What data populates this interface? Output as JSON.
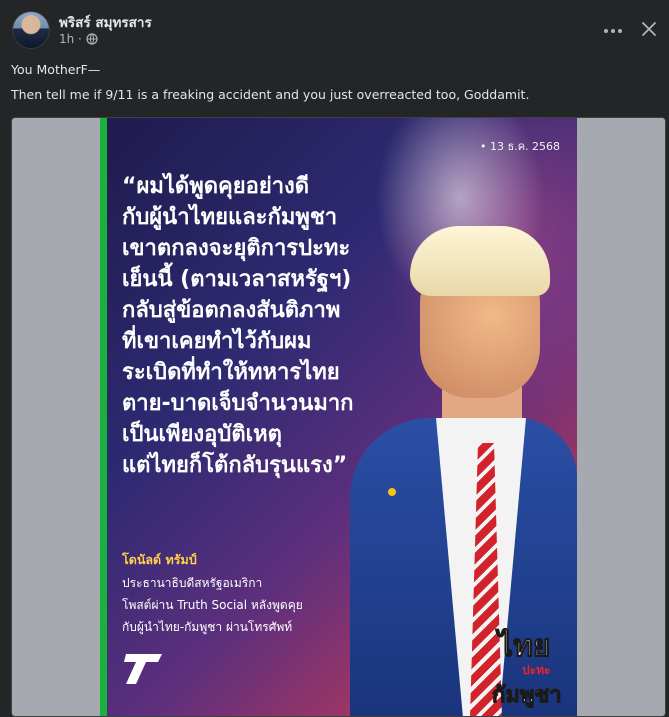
{
  "post": {
    "author_name": "พริสร์ สมุทรสาร",
    "time": "1h ·",
    "lines": [
      "You MotherF—",
      "Then tell me if 9/11 is a freaking accident and you just overreacted too, Goddamit."
    ]
  },
  "header_controls": {
    "more_icon": "more-horizontal-icon",
    "close_icon": "close-icon",
    "privacy_icon": "globe-icon"
  },
  "poster": {
    "date": "• 13 ธ.ค. 2568",
    "quote_lines": [
      "“ผมได้พูดคุยอย่างดี",
      "กับผู้นำไทยและกัมพูชา",
      "เขาตกลงจะยุติการปะทะ",
      "เย็นนี้ (ตามเวลาสหรัฐฯ)",
      "กลับสู่ข้อตกลงสันติภาพ",
      "ที่เขาเคยทำไว้กับผม",
      "ระเบิดที่ทำให้ทหารไทย",
      "ตาย-บาดเจ็บจำนวนมาก",
      "เป็นเพียงอุบัติเหตุ",
      "แต่ไทยก็โต้กลับรุนแรง”"
    ],
    "speaker": "โดนัลด์ ทรัมป์",
    "speaker_details": [
      "ประธานาธิบดีสหรัฐอเมริกา",
      "โพสต์ผ่าน Truth Social หลังพูดคุย",
      "กับผู้นำไทย-กัมพูชา ผ่านโทรศัพท์"
    ],
    "watermark": {
      "top": "ไทย",
      "mid": "ปะทะ",
      "bottom": "กัมพูชา"
    },
    "colors": {
      "accent_bar": "#19b23c",
      "speaker": "#ffd24a"
    }
  }
}
